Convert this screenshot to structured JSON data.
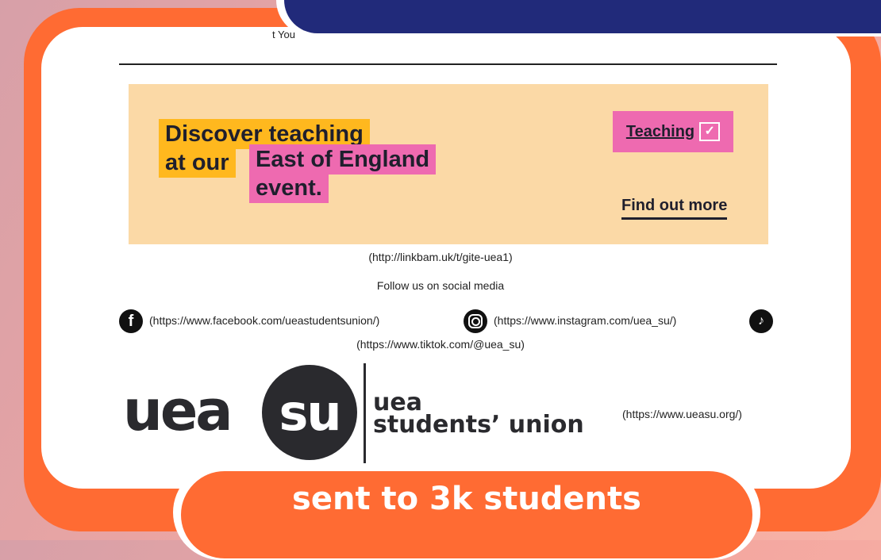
{
  "email": {
    "truncated_text": "t You",
    "banner": {
      "headline_line1": "Discover teaching",
      "headline_line2_a": "at our",
      "headline_line2_b": "East of England",
      "headline_line3": "event.",
      "badge_label": "Teaching",
      "badge_check": "✓",
      "cta_label": "Find out more",
      "colors": {
        "background": "#fbd9a6",
        "yellow": "#ffb81e",
        "pink": "#ee6ab0"
      }
    },
    "banner_link": "(http://linkbam.uk/t/gite-uea1)",
    "social_heading": "Follow us on social media",
    "social": {
      "facebook_icon": "f",
      "facebook_link": "(https://www.facebook.com/ueastudentsunion/)",
      "instagram_link": "(https://www.instagram.com/uea_su/)",
      "tiktok_icon": "♪",
      "tiktok_link": "(https://www.tiktok.com/@uea_su)"
    },
    "logo": {
      "word": "uea",
      "circle": "su",
      "line1": "uea",
      "line2": "students’ union"
    },
    "logo_link": "(https://www.ueasu.org/)"
  },
  "overlay": {
    "caption": "sent to 3k students",
    "colors": {
      "accent": "#ff6b33",
      "top_bar": "#212a7a"
    }
  }
}
